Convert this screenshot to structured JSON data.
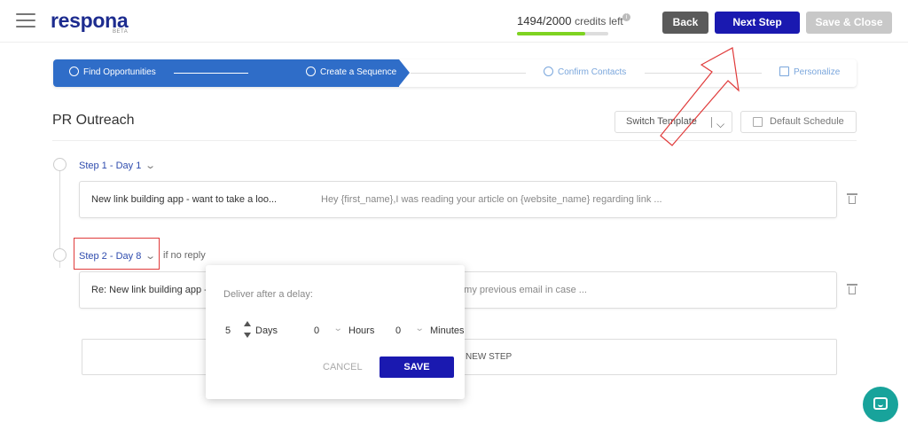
{
  "header": {
    "logo": "respona",
    "logo_badge": "BETA",
    "credits_value": "1494/2000",
    "credits_suffix": "credits left",
    "credits_progress": 0.747,
    "back_label": "Back",
    "next_label": "Next Step",
    "save_close_label": "Save & Close"
  },
  "stepper": {
    "steps": [
      {
        "label": "Find Opportunities",
        "icon": "search-icon",
        "state": "done"
      },
      {
        "label": "Create a Sequence",
        "icon": "refresh-icon",
        "state": "active"
      },
      {
        "label": "Confirm Contacts",
        "icon": "user-circle-icon",
        "state": "pending"
      },
      {
        "label": "Personalize",
        "icon": "edit-icon",
        "state": "pending"
      }
    ]
  },
  "sequence": {
    "title": "PR Outreach",
    "switch_template_label": "Switch Template",
    "default_schedule_label": "Default Schedule",
    "steps": [
      {
        "label": "Step 1 - Day 1",
        "subject": "New link building app - want to take a loo...",
        "preview": "Hey {first_name},I was reading your article on {website_name} regarding link ..."
      },
      {
        "label": "Step 2 - Day 8",
        "condition": "if no reply",
        "subject": "Re: New link building app -",
        "preview": "e my previous email in case ..."
      }
    ],
    "new_step_label": "NEW STEP"
  },
  "delay_popup": {
    "title": "Deliver after a delay:",
    "days_value": "5",
    "days_label": "Days",
    "hours_value": "0",
    "hours_label": "Hours",
    "minutes_value": "0",
    "minutes_label": "Minutes",
    "cancel_label": "CANCEL",
    "save_label": "SAVE"
  },
  "colors": {
    "primary": "#1a19b0",
    "stepper_active": "#2f6dc8",
    "progress": "#7ed321",
    "annotation": "#e03b3b",
    "chat": "#18a39b"
  }
}
